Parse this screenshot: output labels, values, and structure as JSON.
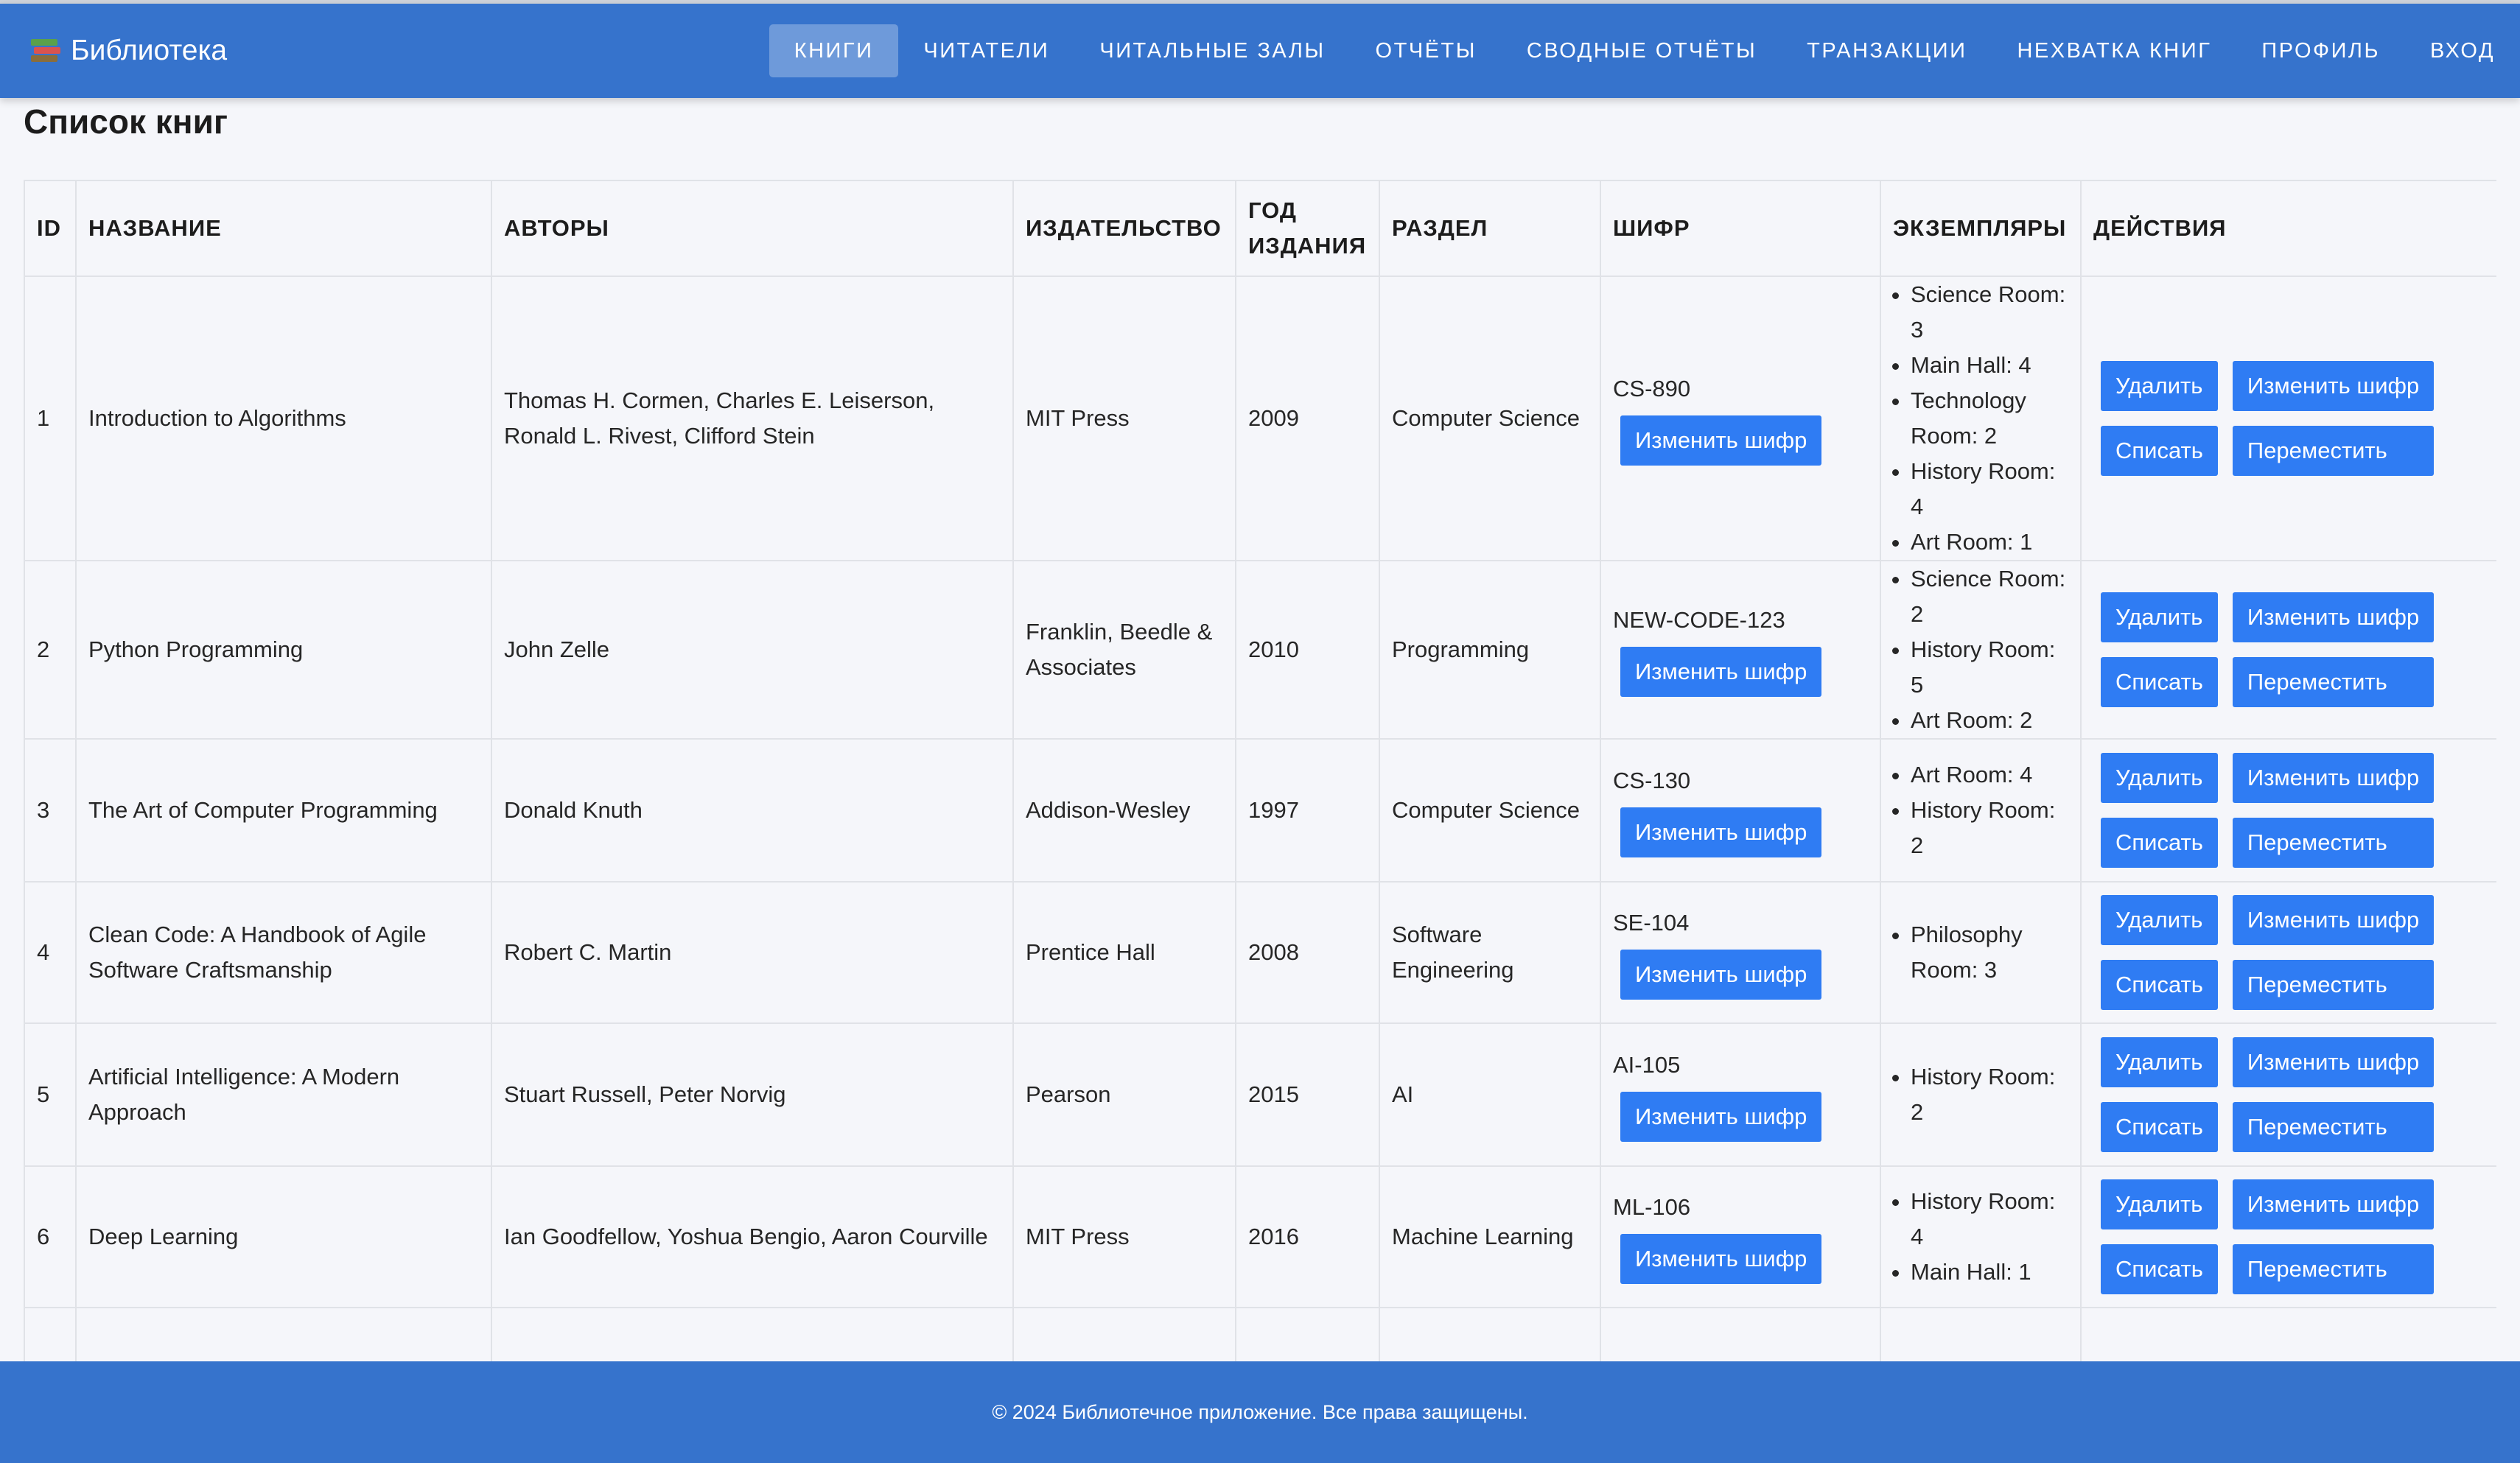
{
  "brand": {
    "title": "Библиотека",
    "icon": "books-icon"
  },
  "nav": [
    {
      "label": "Книги",
      "active": true
    },
    {
      "label": "Читатели"
    },
    {
      "label": "Читальные залы"
    },
    {
      "label": "Отчёты"
    },
    {
      "label": "Сводные отчёты"
    },
    {
      "label": "Транзакции"
    },
    {
      "label": "Нехватка книг"
    },
    {
      "label": "Профиль"
    },
    {
      "label": "Вход"
    }
  ],
  "page": {
    "title": "Список книг"
  },
  "table": {
    "headers": [
      "ID",
      "Название",
      "Авторы",
      "Издательство",
      "Год издания",
      "Раздел",
      "Шифр",
      "Экземпляры",
      "Действия"
    ],
    "actions": {
      "delete": "Удалить",
      "change_cipher": "Изменить шифр",
      "write_off": "Списать",
      "move": "Переместить"
    },
    "rows": [
      {
        "id": "1",
        "title": "Introduction to Algorithms",
        "authors": "Thomas H. Cormen, Charles E. Leiserson, Ronald L. Rivest, Clifford Stein",
        "publisher": "MIT Press",
        "year": "2009",
        "section": "Computer Science",
        "cipher": "CS-890",
        "copies": [
          "Science Room: 3",
          "Main Hall: 4",
          "Technology Room: 2",
          "History Room: 4",
          "Art Room: 1"
        ]
      },
      {
        "id": "2",
        "title": "Python Programming",
        "authors": "John Zelle",
        "publisher": "Franklin, Beedle & Associates",
        "year": "2010",
        "section": "Programming",
        "cipher": "NEW-CODE-123",
        "copies": [
          "Science Room: 2",
          "History Room: 5",
          "Art Room: 2"
        ]
      },
      {
        "id": "3",
        "title": "The Art of Computer Programming",
        "authors": "Donald Knuth",
        "publisher": "Addison-Wesley",
        "year": "1997",
        "section": "Computer Science",
        "cipher": "CS-130",
        "copies": [
          "Art Room: 4",
          "History Room: 2"
        ]
      },
      {
        "id": "4",
        "title": "Clean Code: A Handbook of Agile Software Craftsmanship",
        "authors": "Robert C. Martin",
        "publisher": "Prentice Hall",
        "year": "2008",
        "section": "Software Engineering",
        "cipher": "SE-104",
        "copies": [
          "Philosophy Room: 3"
        ]
      },
      {
        "id": "5",
        "title": "Artificial Intelligence: A Modern Approach",
        "authors": "Stuart Russell, Peter Norvig",
        "publisher": "Pearson",
        "year": "2015",
        "section": "AI",
        "cipher": "AI-105",
        "copies": [
          "History Room: 2"
        ]
      },
      {
        "id": "6",
        "title": "Deep Learning",
        "authors": "Ian Goodfellow, Yoshua Bengio, Aaron Courville",
        "publisher": "MIT Press",
        "year": "2016",
        "section": "Machine Learning",
        "cipher": "ML-106",
        "copies": [
          "History Room: 4",
          "Main Hall: 1"
        ]
      }
    ]
  },
  "footer": {
    "text": "© 2024 Библиотечное приложение. Все права защищены."
  },
  "colors": {
    "primary": "#3673cc",
    "button": "#2f7cf3",
    "background": "#f5f6fa"
  }
}
